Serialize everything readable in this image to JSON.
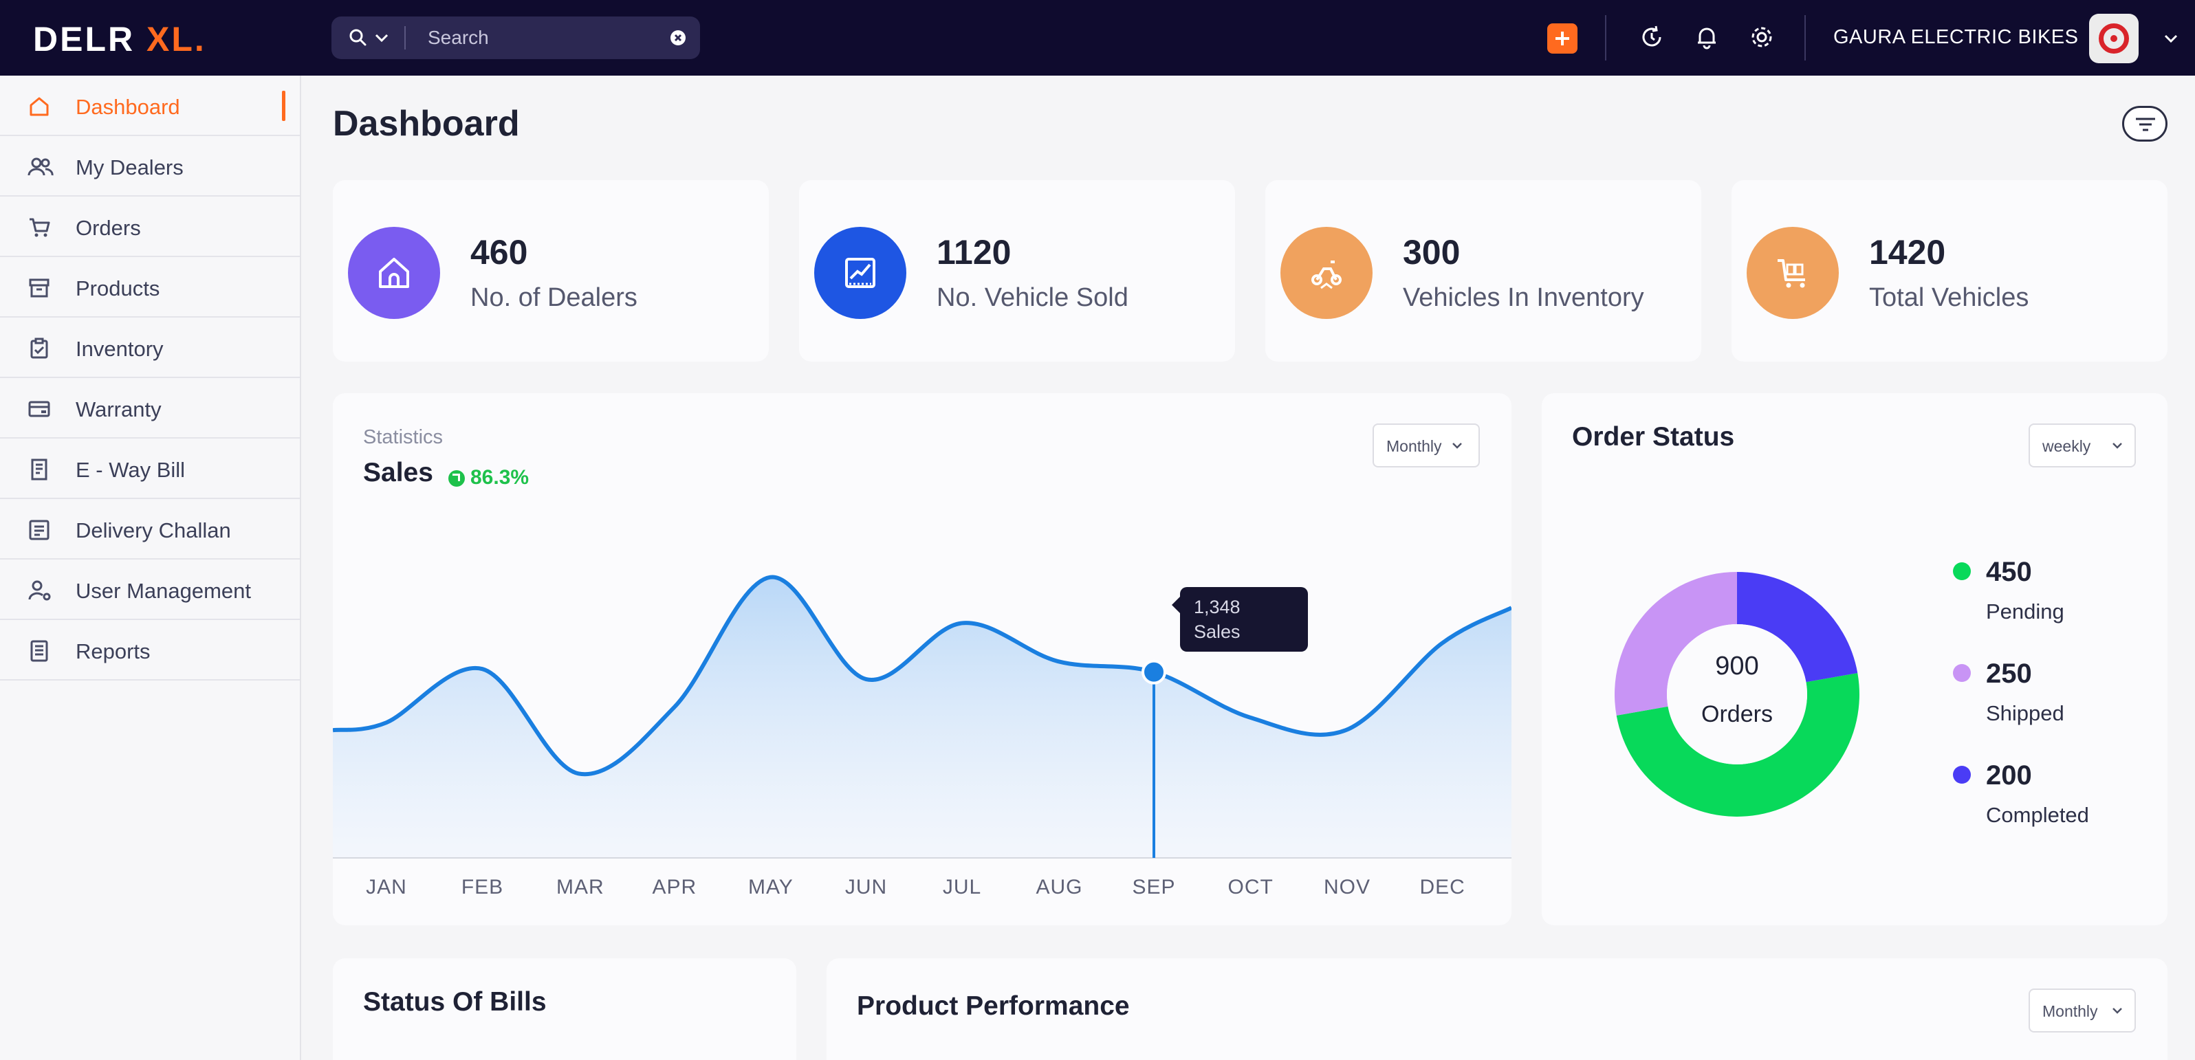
{
  "app": {
    "logo_main": "DELR",
    "logo_accent": "XL",
    "logo_mark": "."
  },
  "header": {
    "search_placeholder": "Search",
    "company": "GAURA ELECTRIC BIKES",
    "icons": [
      "search-icon",
      "chevron-down-icon",
      "clear-icon",
      "plus-icon",
      "refresh-icon",
      "bell-icon",
      "gear-icon",
      "avatar",
      "chevron-down-icon"
    ]
  },
  "sidebar": {
    "items": [
      {
        "label": "Dashboard",
        "icon": "home-icon",
        "active": true
      },
      {
        "label": "My Dealers",
        "icon": "users-icon"
      },
      {
        "label": "Orders",
        "icon": "cart-icon"
      },
      {
        "label": "Products",
        "icon": "box-icon"
      },
      {
        "label": "Inventory",
        "icon": "clipboard-icon"
      },
      {
        "label": "Warranty",
        "icon": "card-icon"
      },
      {
        "label": "E - Way Bill",
        "icon": "bill-icon"
      },
      {
        "label": "Delivery Challan",
        "icon": "list-icon"
      },
      {
        "label": "User Management",
        "icon": "user-cog-icon"
      },
      {
        "label": "Reports",
        "icon": "report-icon"
      }
    ]
  },
  "page": {
    "title": "Dashboard"
  },
  "stats": [
    {
      "value": "460",
      "label": "No. of Dealers",
      "color": "#7a5cf0",
      "icon": "house-icon"
    },
    {
      "value": "1120",
      "label": "No. Vehicle Sold",
      "color": "#1e56e3",
      "icon": "chart-icon"
    },
    {
      "value": "300",
      "label": "Vehicles In Inventory",
      "color": "#f0a25e",
      "icon": "scooter-icon"
    },
    {
      "value": "1420",
      "label": "Total Vehicles",
      "color": "#f0a25e",
      "icon": "cart-icon"
    }
  ],
  "sales": {
    "sublabel": "Statistics",
    "title": "Sales",
    "growth": "86.3%",
    "period": "Monthly",
    "tooltip_value": "1,348",
    "tooltip_label": "Sales"
  },
  "order_status": {
    "title": "Order Status",
    "period": "weekly",
    "center_value": "900",
    "center_label": "Orders",
    "legend": [
      {
        "value": "450",
        "label": "Pending",
        "color": "#08d95a"
      },
      {
        "value": "250",
        "label": "Shipped",
        "color": "#c894f5"
      },
      {
        "value": "200",
        "label": "Completed",
        "color": "#4a3cf5"
      }
    ]
  },
  "bills": {
    "title": "Status Of Bills"
  },
  "product_performance": {
    "title": "Product Performance",
    "period": "Monthly"
  },
  "chart_data": [
    {
      "type": "area",
      "title": "Sales",
      "categories": [
        "JAN",
        "FEB",
        "MAR",
        "APR",
        "MAY",
        "JUN",
        "JUL",
        "AUG",
        "SEP",
        "OCT",
        "NOV",
        "DEC"
      ],
      "values": [
        1150,
        1360,
        950,
        1210,
        1720,
        1320,
        1540,
        1390,
        1348,
        1170,
        1120,
        1460
      ],
      "highlight": {
        "category": "SEP",
        "value": 1348
      },
      "ylim": [
        700,
        1800
      ],
      "grid": false,
      "color": "#1a7fe0"
    },
    {
      "type": "pie",
      "title": "Order Status",
      "categories": [
        "Pending",
        "Shipped",
        "Completed"
      ],
      "values": [
        450,
        250,
        200
      ],
      "colors": [
        "#08d95a",
        "#c894f5",
        "#4a3cf5"
      ],
      "donut": true
    }
  ]
}
